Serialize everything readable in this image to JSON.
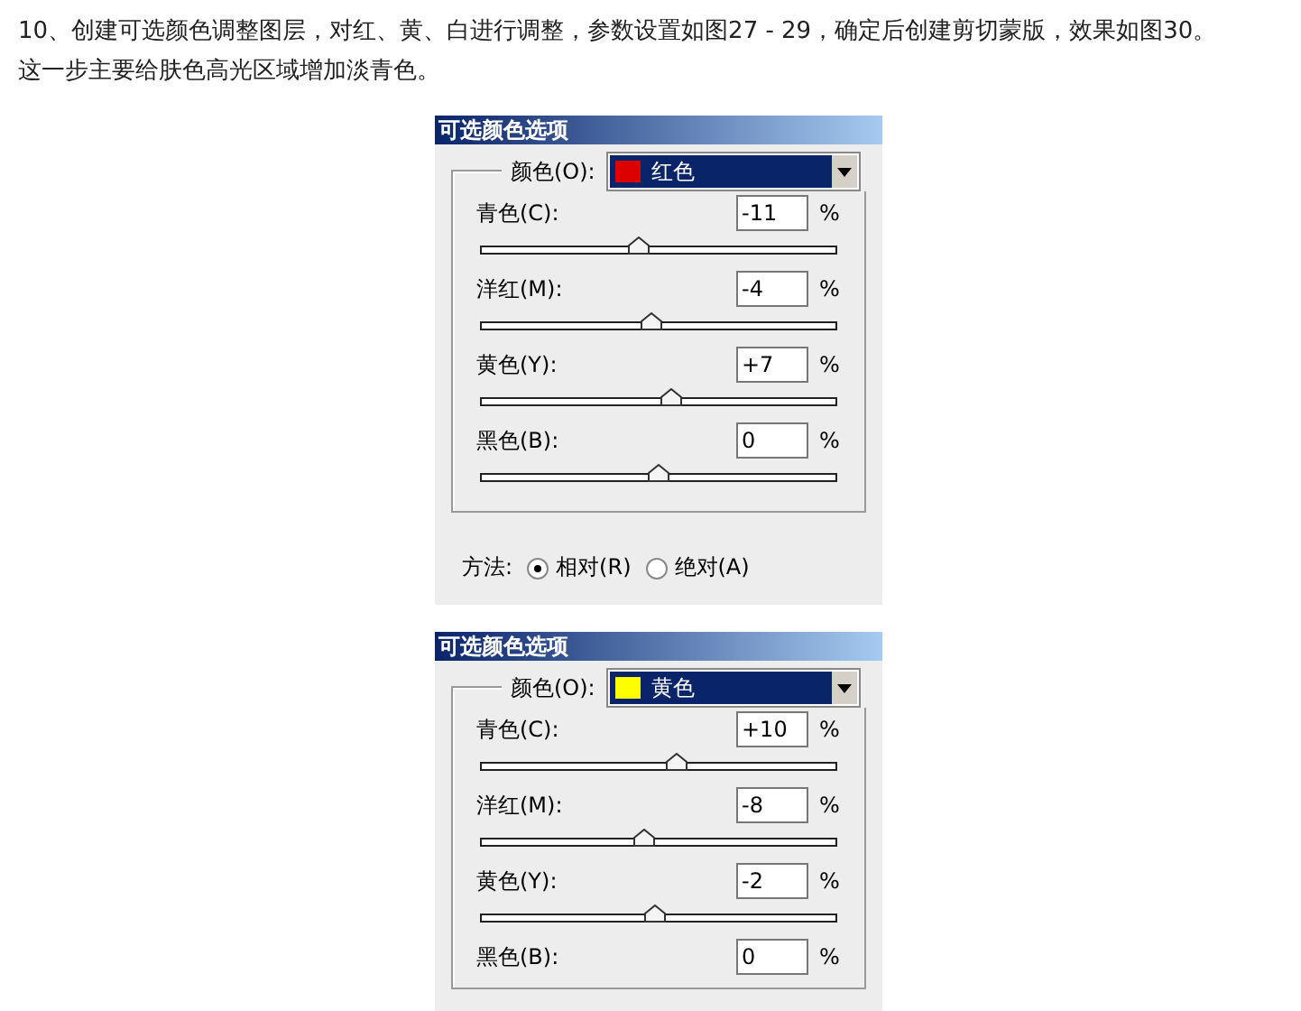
{
  "intro": "10、创建可选颜色调整图层，对红、黄、白进行调整，参数设置如图27 - 29，确定后创建剪切蒙版，效果如图30。这一步主要给肤色高光区域增加淡青色。",
  "dialogs": [
    {
      "title": "可选颜色选项",
      "color_label": "颜色(O):",
      "color_value": "红色",
      "color": "#dd0000",
      "sliders": [
        {
          "label": "青色(C):",
          "value": "-11",
          "unit": "%",
          "level": 0.445
        },
        {
          "label": "洋红(M):",
          "value": "-4",
          "unit": "%",
          "level": 0.48
        },
        {
          "label": "黄色(Y):",
          "value": "+7",
          "unit": "%",
          "level": 0.535
        },
        {
          "label": "黑色(B):",
          "value": "0",
          "unit": "%",
          "level": 0.5
        }
      ],
      "method": {
        "label": "方法:",
        "options": [
          {
            "label": "相对(R)",
            "selected": true
          },
          {
            "label": "绝对(A)",
            "selected": false
          }
        ]
      }
    },
    {
      "title": "可选颜色选项",
      "color_label": "颜色(O):",
      "color_value": "黄色",
      "color": "#ffff00",
      "sliders": [
        {
          "label": "青色(C):",
          "value": "+10",
          "unit": "%",
          "level": 0.55
        },
        {
          "label": "洋红(M):",
          "value": "-8",
          "unit": "%",
          "level": 0.46
        },
        {
          "label": "黄色(Y):",
          "value": "-2",
          "unit": "%",
          "level": 0.49
        },
        {
          "label": "黑色(B):",
          "value": "0",
          "unit": "%"
        }
      ]
    }
  ]
}
